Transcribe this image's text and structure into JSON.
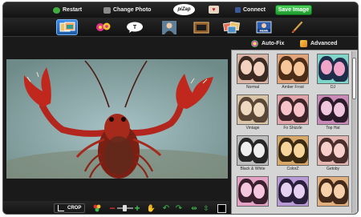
{
  "topbar": {
    "restart_label": "Restart",
    "change_photo_label": "Change Photo",
    "logo_text": "piZap",
    "connect_label": "Connect",
    "save_label": "Save Image"
  },
  "tools": [
    {
      "name": "effects-tool",
      "icon": "photo-effects-icon",
      "active": true
    },
    {
      "name": "stickers-tool",
      "icon": "flowers-icon",
      "active": false
    },
    {
      "name": "text-tool",
      "icon": "speech-bubble-icon",
      "active": false
    },
    {
      "name": "cutout-tool",
      "icon": "person-icon",
      "active": false
    },
    {
      "name": "borders-tool",
      "icon": "frame-icon",
      "active": false
    },
    {
      "name": "collage-tool",
      "icon": "photos-icon",
      "active": false
    },
    {
      "name": "meme-tool",
      "icon": "meme-icon",
      "active": false
    },
    {
      "name": "paint-tool",
      "icon": "brush-icon",
      "active": false
    }
  ],
  "effects_tabs": {
    "auto_fix_label": "Auto-Fix",
    "advanced_label": "Advanced"
  },
  "effects": [
    {
      "label": "Normal",
      "tint": "none"
    },
    {
      "label": "Amber Frost",
      "tint": "amber"
    },
    {
      "label": "DJ",
      "tint": "dj"
    },
    {
      "label": "Vintage",
      "tint": "vintage"
    },
    {
      "label": "Fo Shizzle",
      "tint": "shizzle"
    },
    {
      "label": "Top Hat",
      "tint": "tophat"
    },
    {
      "label": "Black & White",
      "tint": "bw"
    },
    {
      "label": "ColorZ",
      "tint": "colorz"
    },
    {
      "label": "Getoby",
      "tint": "getoby"
    },
    {
      "label": "",
      "tint": "pinky"
    },
    {
      "label": "",
      "tint": "purple"
    },
    {
      "label": "",
      "tint": "warm"
    }
  ],
  "bottombar": {
    "crop_label": "CROP"
  },
  "colors": {
    "save_button": "#2fb23f",
    "active_tool": "#2a78d6",
    "accent_green": "#3fbf52",
    "accent_red": "#e53030"
  }
}
